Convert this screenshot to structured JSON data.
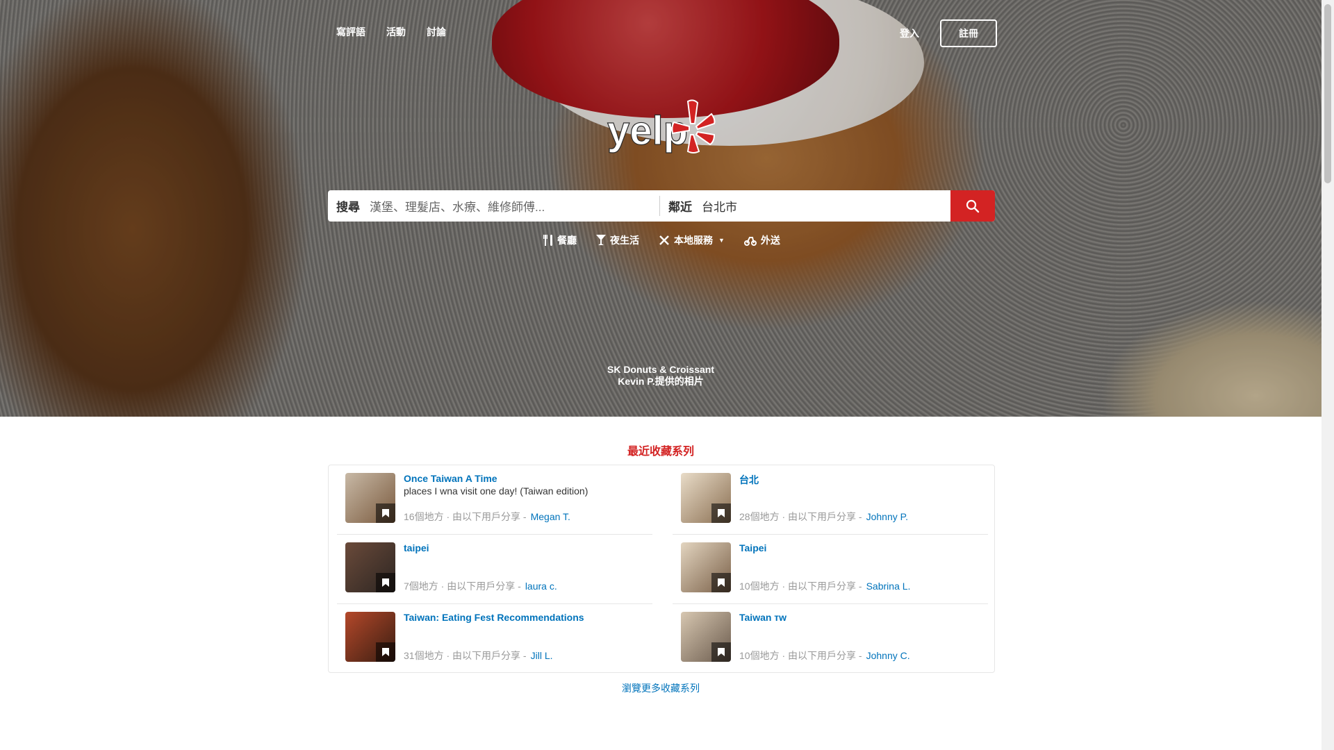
{
  "nav": {
    "links": [
      "寫評語",
      "活動",
      "討論"
    ],
    "login": "登入",
    "signup": "註冊"
  },
  "logo": {
    "text": "yelp"
  },
  "search": {
    "find_label": "搜尋",
    "find_placeholder": "漢堡、理髮店、水療、維修師傅...",
    "near_label": "鄰近",
    "near_value": "台北市"
  },
  "categories": [
    {
      "icon": "restaurant-icon",
      "label": "餐廳"
    },
    {
      "icon": "nightlife-icon",
      "label": "夜生活"
    },
    {
      "icon": "local-services-icon",
      "label": "本地服務"
    },
    {
      "icon": "delivery-icon",
      "label": "外送"
    }
  ],
  "photo_credit": {
    "business": "SK Donuts & Croissant",
    "user": "Kevin P.",
    "suffix": "提供的相片"
  },
  "collections_section": {
    "title": "最近收藏系列",
    "items": [
      {
        "title": "Once Taiwan A Time",
        "desc": "places I wna visit one day! (Taiwan edition)",
        "count": "16個地方",
        "shared": "由以下用戶分享 -",
        "user": "Megan T.",
        "thumb_colors": [
          "#c8b9a6",
          "#7a5a3e"
        ]
      },
      {
        "title": "台北",
        "desc": "",
        "count": "28個地方",
        "shared": "由以下用戶分享 -",
        "user": "Johnny P.",
        "thumb_colors": [
          "#e9dcc8",
          "#8a6f52"
        ]
      },
      {
        "title": "taipei",
        "desc": "",
        "count": "7個地方",
        "shared": "由以下用戶分享 -",
        "user": "laura c.",
        "thumb_colors": [
          "#6a4a3a",
          "#2d2622"
        ]
      },
      {
        "title": "Taipei",
        "desc": "",
        "count": "10個地方",
        "shared": "由以下用戶分享 -",
        "user": "Sabrina L.",
        "thumb_colors": [
          "#e3d5c0",
          "#7a6048"
        ]
      },
      {
        "title": "Taiwan: Eating Fest Recommendations",
        "desc": "",
        "count": "31個地方",
        "shared": "由以下用戶分享 -",
        "user": "Jill L.",
        "thumb_colors": [
          "#b4482a",
          "#3a1e12"
        ]
      },
      {
        "title": "Taiwan тw",
        "desc": "",
        "count": "10個地方",
        "shared": "由以下用戶分享 -",
        "user": "Johnny C.",
        "thumb_colors": [
          "#d7c7b1",
          "#6a5a4c"
        ]
      }
    ],
    "browse_more": "瀏覽更多收藏系列"
  },
  "colors": {
    "brand_red": "#d32323",
    "link_blue": "#0073bb"
  }
}
